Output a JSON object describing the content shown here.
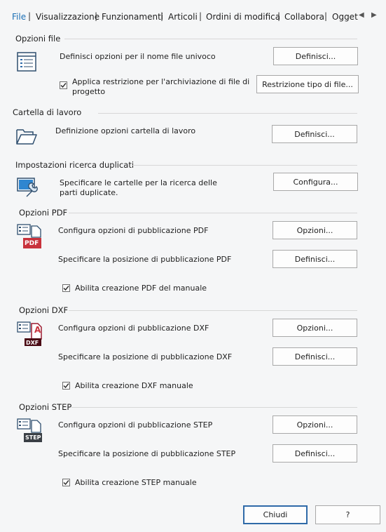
{
  "tabs": [
    {
      "label": "File"
    },
    {
      "label": "Visualizzazione"
    },
    {
      "label": "Funzionamenti"
    },
    {
      "label": "Articoli"
    },
    {
      "label": "Ordini di modifica"
    },
    {
      "label": "Collabora"
    },
    {
      "label": "Ogget"
    }
  ],
  "tab_separator": "|",
  "tab_scroll_left": "◀",
  "tab_scroll_right": "▶",
  "sections": {
    "file_options": {
      "title": "Opzioni file",
      "row1_label": "Definisci opzioni per il nome file univoco",
      "row1_button": "Definisci...",
      "restriction_label": "Applica restrizione per l'archiviazione di file di progetto",
      "restriction_checked": true,
      "restriction_button": "Restrizione tipo di file..."
    },
    "work_folder": {
      "title": "Cartella di lavoro",
      "row_label": "Definizione opzioni cartella di lavoro",
      "row_button": "Definisci..."
    },
    "duplicates": {
      "title": "Impostazioni ricerca duplicati",
      "row_label": "Specificare le cartelle per la ricerca delle parti duplicate.",
      "row_button": "Configura..."
    },
    "pdf": {
      "title": "Opzioni PDF",
      "icon_text": "PDF",
      "row1_label": "Configura opzioni di pubblicazione PDF",
      "row1_button": "Opzioni...",
      "row2_label": "Specificare la posizione di pubblicazione PDF",
      "row2_button": "Definisci...",
      "check_label": "Abilita creazione PDF del manuale",
      "checked": true
    },
    "dxf": {
      "title": "Opzioni DXF",
      "icon_text": "DXF",
      "icon_letter": "A",
      "row1_label": "Configura opzioni di pubblicazione DXF",
      "row1_button": "Opzioni...",
      "row2_label": "Specificare la posizione di pubblicazione DXF",
      "row2_button": "Definisci...",
      "check_label": "Abilita creazione DXF manuale",
      "checked": true
    },
    "step": {
      "title": "Opzioni STEP",
      "icon_text": "STEP",
      "row1_label": "Configura opzioni di pubblicazione STEP",
      "row1_button": "Opzioni...",
      "row2_label": "Specificare la posizione di pubblicazione STEP",
      "row2_button": "Definisci...",
      "check_label": "Abilita creazione STEP manuale",
      "checked": true
    }
  },
  "footer": {
    "close_label": "Chiudi",
    "help_label": "?"
  },
  "colors": {
    "active_tab": "#1a6fb5",
    "background": "#f5f6f7",
    "pdf_red": "#c8323c",
    "primary_border": "#2f6aa8"
  }
}
